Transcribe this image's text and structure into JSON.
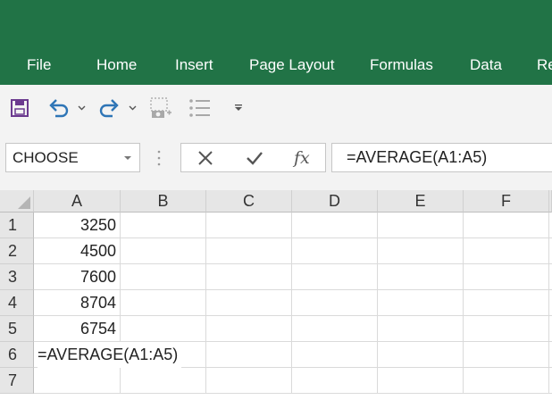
{
  "ribbon": {
    "tabs": [
      "File",
      "Home",
      "Insert",
      "Page Layout",
      "Formulas",
      "Data",
      "Re"
    ]
  },
  "formula_bar": {
    "name_box_value": "CHOOSE",
    "fx_label": "fx",
    "formula": "=AVERAGE(A1:A5)"
  },
  "sheet": {
    "columns": [
      "A",
      "B",
      "C",
      "D",
      "E",
      "F"
    ],
    "rows": [
      "1",
      "2",
      "3",
      "4",
      "5",
      "6",
      "7"
    ],
    "cells": {
      "A1": "3250",
      "A2": "4500",
      "A3": "7600",
      "A4": "8704",
      "A5": "6754"
    },
    "editing_cell_text": "=AVERAGE(A1:A5)"
  },
  "colors": {
    "ribbon": "#217346",
    "toolbar_bg": "#f3f3f3",
    "accent_blue": "#2e75b6",
    "save_purple": "#6b3a8f"
  },
  "icons": [
    "save-icon",
    "undo-icon",
    "redo-icon",
    "camera-icon",
    "list-icon",
    "customize-icon",
    "cancel-icon",
    "enter-icon"
  ]
}
